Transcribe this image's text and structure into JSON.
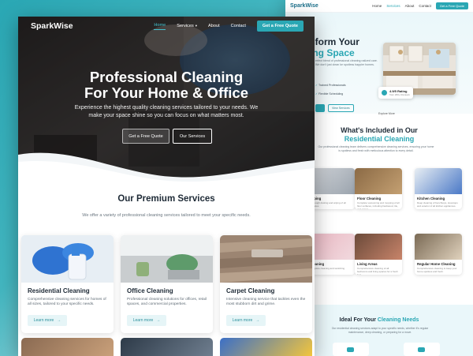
{
  "back_page": {
    "logo": "SparkWise",
    "nav": [
      "Home",
      "Services",
      "About",
      "Contact"
    ],
    "nav_cta": "Get a Free Quote",
    "hero_title_1": "sform Your",
    "hero_title_2": "ing Space",
    "hero_par": "erfect blend of professional cleaning nalized care. We don't just clean ke spotless happier homes.",
    "features": [
      "Trained Professionals",
      "Flexible Scheduling"
    ],
    "view_services": "View Services",
    "rating_title": "4.9/5 Rating",
    "rating_sub": "from 200+ Reviews",
    "explore": "Explore More",
    "whats_title": "What's Included in Our",
    "whats_accent": "Residential Cleaning",
    "whats_sub": "Our professional cleaning team delivers comprehensive cleaning services, ensuring your home is spotless and fresh with meticulous attention to every detail.",
    "cards": [
      {
        "title": "Wiping",
        "sub": "Thorough dusting and wiping of all surfaces"
      },
      {
        "title": "Floor Cleaning",
        "sub": "Complete vacuuming and mopping of all floor surfaces, including hardwood, tile, and carpet."
      },
      {
        "title": "Kitchen Cleaning",
        "sub": "Deep cleaning of benchtops, stovetops and exterior of all kitchen appliances."
      },
      {
        "title": "Cleaning",
        "sub": "Complete cleaning and sanitizing"
      },
      {
        "title": "Living Areas",
        "sub": "Comprehensive cleaning of all bedrooms and living spaces for a fresh feel."
      },
      {
        "title": "Regular Home Cleaning",
        "sub": "Comprehensive cleaning to keep your home spotless and fresh."
      }
    ],
    "ideal_title": "Ideal For Your",
    "ideal_accent": "Cleaning Needs",
    "ideal_sub": "Our residential cleaning services adapt to your specific needs, whether it's regular maintenance, deep cleaning, or preparing for a move."
  },
  "front_page": {
    "logo": "SparkWise",
    "nav": {
      "home": "Home",
      "services": "Services",
      "about": "About",
      "contact": "Contact",
      "cta": "Get a Free Quote"
    },
    "hero": {
      "title_line1": "Professional Cleaning",
      "title_line2": "For Your Home & Office",
      "subtitle": "Experience the highest quality cleaning services tailored to your needs. We make your space shine so you can focus on what matters most.",
      "btn_quote": "Get a Free Quote",
      "btn_services": "Our Services"
    },
    "services": {
      "title": "Our Premium Services",
      "subtitle": "We offer a variety of professional cleaning services tailored to meet your specific needs.",
      "cards": [
        {
          "title": "Residential Cleaning",
          "desc": "Comprehensive cleaning services for homes of all sizes, tailored to your specific needs.",
          "more": "Learn more"
        },
        {
          "title": "Office Cleaning",
          "desc": "Professional cleaning solutions for offices, retail spaces, and commercial properties.",
          "more": "Learn more"
        },
        {
          "title": "Carpet Cleaning",
          "desc": "Intensive cleaning service that tackles even the most stubborn dirt and grime.",
          "more": "Learn more"
        }
      ]
    }
  },
  "colors": {
    "accent": "#2aa7b4",
    "dark_text": "#1e2a36",
    "muted_text": "#6b7780"
  }
}
